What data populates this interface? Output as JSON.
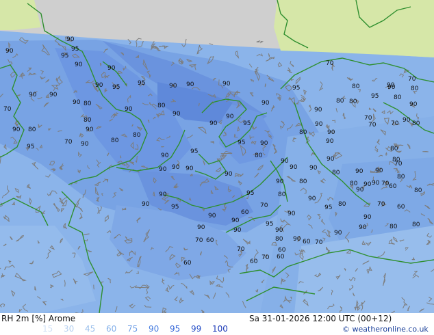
{
  "footer": {
    "title": "RH 2m [%] Arome",
    "datetime": "Sa 31-01-2026 12:00 UTC (00+12)",
    "credit": "© weatheronline.co.uk",
    "legend": [
      {
        "label": "15",
        "color": "#d2e2f6"
      },
      {
        "label": "30",
        "color": "#b5d0f0"
      },
      {
        "label": "45",
        "color": "#9cc0ec"
      },
      {
        "label": "60",
        "color": "#86b2ea"
      },
      {
        "label": "75",
        "color": "#6f9ee6"
      },
      {
        "label": "90",
        "color": "#4a7fe0"
      },
      {
        "label": "95",
        "color": "#3566d8"
      },
      {
        "label": "99",
        "color": "#2a52c8"
      },
      {
        "label": "100",
        "color": "#1c3ab8"
      }
    ]
  },
  "map": {
    "colors": {
      "outside": "#cfcfcf",
      "base": "#8bb4ea",
      "land_out": "#d6e7a8",
      "coast": "#2f8f2f",
      "isoline": "#7d7d7d"
    },
    "isolines": [
      {
        "label": "90"
      },
      {
        "label": "95"
      },
      {
        "label": "90"
      },
      {
        "label": "95"
      },
      {
        "label": "90"
      },
      {
        "label": "90"
      },
      {
        "label": "90"
      },
      {
        "label": "95"
      },
      {
        "label": "90"
      },
      {
        "label": "90"
      },
      {
        "label": "95"
      },
      {
        "label": "90"
      },
      {
        "label": "90"
      },
      {
        "label": "90"
      },
      {
        "label": "90"
      },
      {
        "label": "80"
      },
      {
        "label": "70"
      },
      {
        "label": "90"
      },
      {
        "label": "80"
      },
      {
        "label": "90"
      },
      {
        "label": "80"
      },
      {
        "label": "90"
      },
      {
        "label": "80"
      },
      {
        "label": "90"
      },
      {
        "label": "70"
      },
      {
        "label": "80"
      },
      {
        "label": "90"
      },
      {
        "label": "90"
      },
      {
        "label": "95"
      },
      {
        "label": "90"
      },
      {
        "label": "95"
      },
      {
        "label": "90"
      },
      {
        "label": "90"
      },
      {
        "label": "80"
      },
      {
        "label": "90"
      },
      {
        "label": "90"
      },
      {
        "label": "95"
      },
      {
        "label": "90"
      },
      {
        "label": "80"
      },
      {
        "label": "90"
      },
      {
        "label": "95"
      },
      {
        "label": "90"
      },
      {
        "label": "95"
      },
      {
        "label": "90"
      },
      {
        "label": "90"
      },
      {
        "label": "90"
      },
      {
        "label": "90"
      },
      {
        "label": "80"
      },
      {
        "label": "90"
      },
      {
        "label": "90"
      },
      {
        "label": "95"
      },
      {
        "label": "90"
      },
      {
        "label": "80"
      },
      {
        "label": "90"
      },
      {
        "label": "90"
      },
      {
        "label": "80"
      },
      {
        "label": "90"
      },
      {
        "label": "90"
      },
      {
        "label": "90"
      },
      {
        "label": "90"
      },
      {
        "label": "80"
      },
      {
        "label": "70"
      },
      {
        "label": "80"
      },
      {
        "label": "80"
      },
      {
        "label": "70"
      },
      {
        "label": "90"
      },
      {
        "label": "90"
      },
      {
        "label": "80"
      },
      {
        "label": "90"
      },
      {
        "label": "70"
      },
      {
        "label": "80"
      },
      {
        "label": "95"
      },
      {
        "label": "90"
      },
      {
        "label": "80"
      },
      {
        "label": "70"
      },
      {
        "label": "80"
      },
      {
        "label": "70"
      },
      {
        "label": "80"
      },
      {
        "label": "70"
      },
      {
        "label": "80"
      },
      {
        "label": "70"
      },
      {
        "label": "80"
      },
      {
        "label": "90"
      },
      {
        "label": "60"
      },
      {
        "label": "80"
      },
      {
        "label": "60"
      },
      {
        "label": "70"
      },
      {
        "label": "80"
      },
      {
        "label": "90"
      },
      {
        "label": "95"
      },
      {
        "label": "90"
      },
      {
        "label": "80"
      },
      {
        "label": "70"
      },
      {
        "label": "60"
      },
      {
        "label": "90"
      },
      {
        "label": "90"
      },
      {
        "label": "95"
      },
      {
        "label": "90"
      },
      {
        "label": "80"
      },
      {
        "label": "90"
      },
      {
        "label": "90"
      },
      {
        "label": "80"
      },
      {
        "label": "80"
      },
      {
        "label": "90"
      },
      {
        "label": "90"
      },
      {
        "label": "70"
      },
      {
        "label": "60"
      },
      {
        "label": "60"
      },
      {
        "label": "60"
      },
      {
        "label": "70"
      },
      {
        "label": "60"
      },
      {
        "label": "70"
      },
      {
        "label": "60"
      },
      {
        "label": "70"
      },
      {
        "label": "60"
      },
      {
        "label": "90"
      },
      {
        "label": "90"
      },
      {
        "label": "95"
      },
      {
        "label": "90"
      },
      {
        "label": "90"
      },
      {
        "label": "80"
      },
      {
        "label": "90"
      },
      {
        "label": "95"
      },
      {
        "label": "80"
      },
      {
        "label": "90"
      }
    ]
  }
}
